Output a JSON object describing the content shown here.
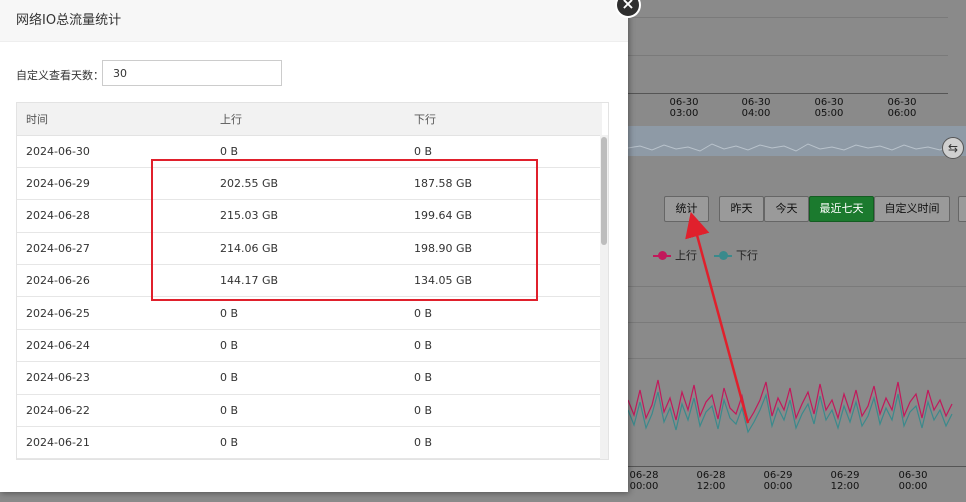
{
  "modal": {
    "title": "网络IO总流量统计",
    "close_glyph": "×",
    "days_label": "自定义查看天数：",
    "days_value": "30",
    "columns": [
      "时间",
      "上行",
      "下行"
    ],
    "rows": [
      [
        "2024-06-30",
        "0 B",
        "0 B"
      ],
      [
        "2024-06-29",
        "202.55 GB",
        "187.58 GB"
      ],
      [
        "2024-06-28",
        "215.03 GB",
        "199.64 GB"
      ],
      [
        "2024-06-27",
        "214.06 GB",
        "198.90 GB"
      ],
      [
        "2024-06-26",
        "144.17 GB",
        "134.05 GB"
      ],
      [
        "2024-06-25",
        "0 B",
        "0 B"
      ],
      [
        "2024-06-24",
        "0 B",
        "0 B"
      ],
      [
        "2024-06-23",
        "0 B",
        "0 B"
      ],
      [
        "2024-06-22",
        "0 B",
        "0 B"
      ],
      [
        "2024-06-21",
        "0 B",
        "0 B"
      ]
    ]
  },
  "background": {
    "top_ticks": [
      [
        "06-30",
        "03:00"
      ],
      [
        "06-30",
        "04:00"
      ],
      [
        "06-30",
        "05:00"
      ],
      [
        "06-30",
        "06:00"
      ]
    ],
    "buttons": {
      "stats": "统计",
      "yesterday": "昨天",
      "today": "今天",
      "last7": "最近七天",
      "custom": "自定义时间"
    },
    "legend": {
      "up": "上行",
      "down": "下行",
      "up_color": "#c2185b",
      "down_color": "#3a8a8c"
    },
    "bottom_ticks": [
      [
        "06-28",
        "00:00"
      ],
      [
        "06-28",
        "12:00"
      ],
      [
        "06-29",
        "00:00"
      ],
      [
        "06-29",
        "12:00"
      ],
      [
        "06-30",
        "00:00"
      ]
    ]
  },
  "annotation": {
    "box_color": "#e0202c",
    "arrow_color": "#e0202c"
  }
}
